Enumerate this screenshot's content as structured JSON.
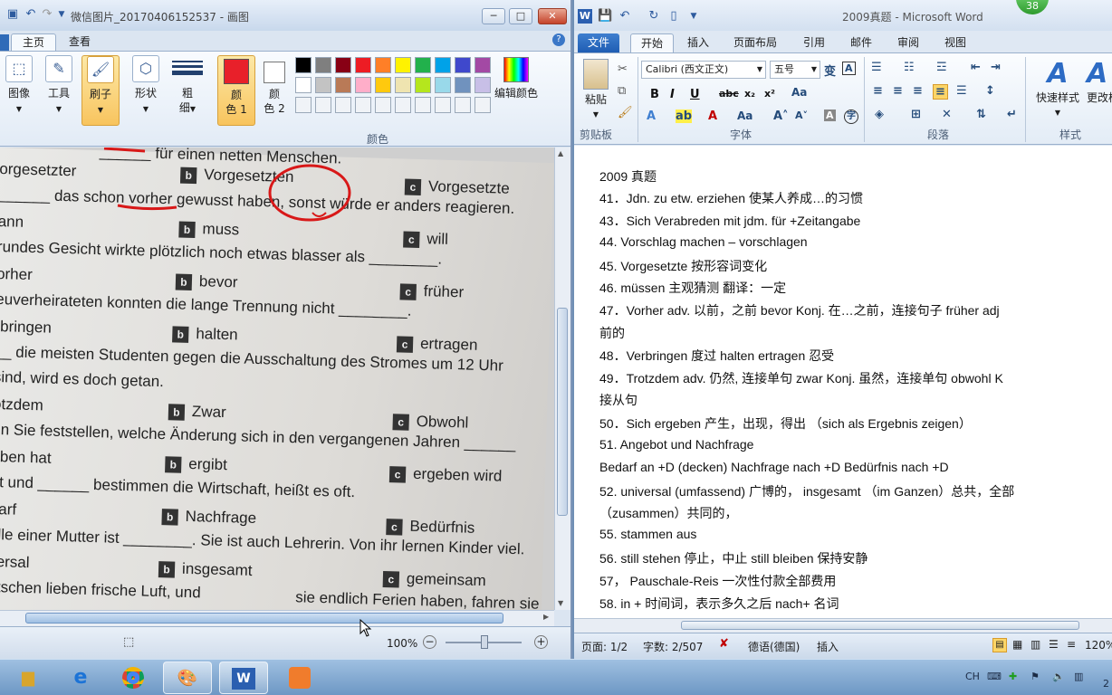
{
  "paint": {
    "title": "微信图片_20170406152537 - 画图",
    "tabs": [
      "主页",
      "查看"
    ],
    "tools": {
      "image": "图像",
      "tools": "工具",
      "brush": "刷子",
      "shapes": "形状",
      "size_1": "粗",
      "size_2": "细",
      "color1_a": "颜",
      "color1_b": "色 1",
      "color2_a": "颜",
      "color2_b": "色 2",
      "edit_colors": "编辑颜色",
      "colors_group": "颜色"
    },
    "color1": "#e8202a",
    "palette": [
      "#000000",
      "#7f7f7f",
      "#880015",
      "#ed1c24",
      "#ff7f27",
      "#fff200",
      "#22b14c",
      "#00a2e8",
      "#3f48cc",
      "#a349a4",
      "#ffffff",
      "#c3c3c3",
      "#b97a57",
      "#ffaec9",
      "#ffc90e",
      "#efe4b0",
      "#b5e61d",
      "#99d9ea",
      "#7092be",
      "#c8bfe7"
    ],
    "photo_lines": [
      "______ für einen netten Menschen.",
      "orgesetzter",
      "______ das schon vorher gewusst haben, sonst würde er anders reagieren.",
      "ann",
      "rundes Gesicht wirkte plötzlich noch etwas blasser als ________.",
      "orher",
      "euverheirateten konnten die lange Trennung nicht ________.",
      "rbringen",
      "__ die meisten Studenten gegen die Ausschaltung des Stromes um 12 Uhr",
      "sind, wird es doch getan.",
      "otzdem",
      "en Sie feststellen, welche Änderung sich in den vergangenen Jahren ______",
      "eben hat",
      "ot und ______ bestimmen die Wirtschaft, heißt es oft.",
      "darf",
      "olle einer Mutter ist ________. Sie ist auch Lehrerin. Von ihr lernen Kinder viel.",
      "versal",
      "utschen lieben frische Luft, und",
      "sie endlich Ferien haben, fahren sie"
    ],
    "photo_options": [
      {
        "letter": "b",
        "text": "Vorgesetzten"
      },
      {
        "letter": "c",
        "text": "Vorgesetzte"
      },
      {
        "letter": "b",
        "text": "muss"
      },
      {
        "letter": "c",
        "text": "will"
      },
      {
        "letter": "b",
        "text": "bevor"
      },
      {
        "letter": "c",
        "text": "früher"
      },
      {
        "letter": "b",
        "text": "halten"
      },
      {
        "letter": "c",
        "text": "ertragen"
      },
      {
        "letter": "b",
        "text": "Zwar"
      },
      {
        "letter": "c",
        "text": "Obwohl"
      },
      {
        "letter": "b",
        "text": "ergibt"
      },
      {
        "letter": "c",
        "text": "ergeben wird"
      },
      {
        "letter": "b",
        "text": "Nachfrage"
      },
      {
        "letter": "c",
        "text": "Bedürfnis"
      },
      {
        "letter": "b",
        "text": "insgesamt"
      },
      {
        "letter": "c",
        "text": "gemeinsam"
      }
    ],
    "zoom": "100%"
  },
  "word": {
    "title": "2009真题 - Microsoft Word",
    "badge": "38",
    "tabs": [
      "文件",
      "开始",
      "插入",
      "页面布局",
      "引用",
      "邮件",
      "审阅",
      "视图"
    ],
    "font_name": "Calibri (西文正文)",
    "font_size": "五号",
    "groups": {
      "clipboard": "剪贴板",
      "font": "字体",
      "paragraph": "段落",
      "styles": "样式"
    },
    "paste": "粘贴",
    "quick_styles": "快速样式",
    "change_styles": "更改样式",
    "lines": [
      "2009 真题",
      "41．Jdn. zu etw. erziehen  使某人养成…的习惯",
      "43．Sich Verabreden mit jdm. für +Zeitangabe",
      "44.   Vorschlag machen – vorschlagen",
      "45.   Vorgesetzte  按形容词变化",
      "46. müssen  主观猜测  翻译：一定",
      "47．Vorher adv.  以前，之前        bevor Konj.  在…之前，连接句子      früher adj",
      "前的",
      "48．Verbringen  度过      halten      ertragen  忍受",
      "49．Trotzdem    adv.  仍然, 连接单句      zwar Konj.  虽然，连接单句     obwohl K",
      "接从句",
      "50．Sich ergeben  产生，出现，得出  （sich als Ergebnis zeigen）",
      "51.   Angebot und Nachfrage",
      "       Bedarf an +D (decken)       Nachfrage nach +D      Bedürfnis nach +D",
      "52.   universal  (umfassend)  广博的，   insgesamt   （im  Ganzen）总共，全部",
      "（zusammen）共同的，",
      "55. stammen aus",
      "56. still stehen  停止，中止        still bleiben  保持安静",
      "57，  Pauschale-Reis  一次性付款全部费用",
      "58. in +  时间词，表示多久之后    nach+  名词"
    ],
    "status": {
      "page": "页面: 1/2",
      "words": "字数: 2/507",
      "language": "德语(德国)",
      "mode": "插入",
      "zoom": "120%"
    }
  },
  "taskbar": {
    "lang": "CH",
    "date": "2"
  }
}
